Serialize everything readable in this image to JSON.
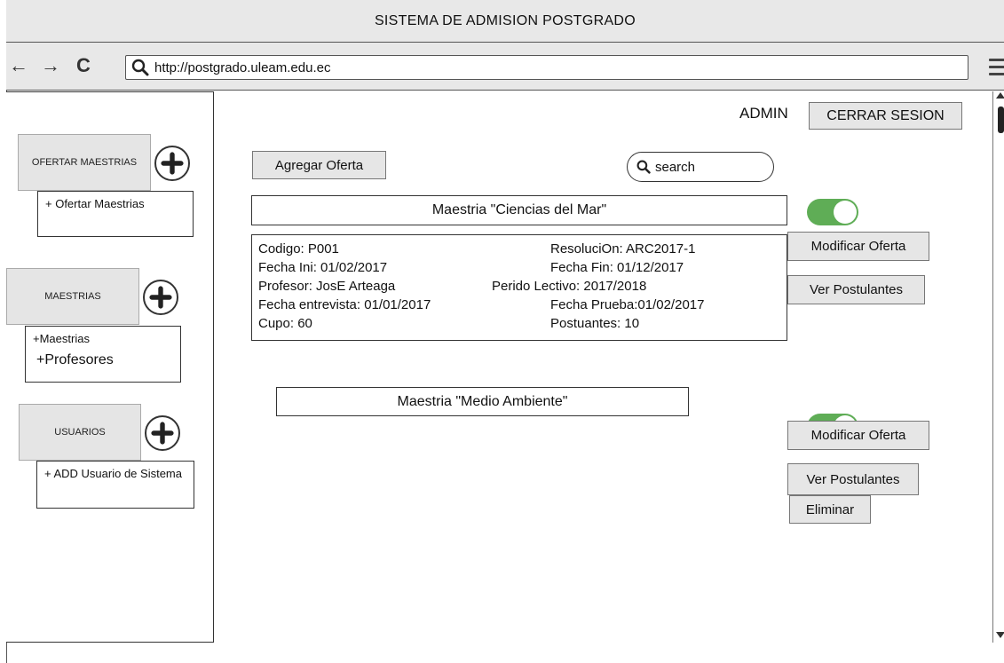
{
  "window": {
    "title": "SISTEMA DE ADMISION POSTGRADO"
  },
  "browser": {
    "back_icon": "←",
    "forward_icon": "→",
    "reload_icon": "C",
    "url": "http://postgrado.uleam.edu.ec"
  },
  "sidebar": {
    "ofertar": {
      "button": "OFERTAR MAESTRIAS",
      "items": [
        "+ Ofertar Maestrias"
      ]
    },
    "maestrias": {
      "button": "MAESTRIAS",
      "items": [
        "+Maestrias",
        "+Profesores"
      ]
    },
    "usuarios": {
      "button": "USUARIOS",
      "items": [
        "+ ADD Usuario de Sistema"
      ]
    }
  },
  "header": {
    "user": "ADMIN",
    "logout": "CERRAR SESION"
  },
  "actions": {
    "add_offer": "Agregar Oferta",
    "search_placeholder": "search"
  },
  "offers": [
    {
      "title": "Maestria \"Ciencias del Mar\"",
      "enabled": true,
      "details": {
        "codigo": "Codigo: P001",
        "resolucion": "ResoluciOn: ARC2017-1",
        "fecha_ini": "Fecha Ini: 01/02/2017",
        "fecha_fin": "Fecha Fin: 01/12/2017",
        "profesor": "Profesor: JosE Arteaga",
        "periodo": "Perido Lectivo: 2017/2018",
        "fecha_entrevista": "Fecha entrevista: 01/01/2017",
        "fecha_prueba": "Fecha Prueba:01/02/2017",
        "cupo": "Cupo: 60",
        "postulantes": "Postuantes: 10"
      },
      "buttons": {
        "modify": "Modificar Oferta",
        "view": "Ver Postulantes"
      }
    },
    {
      "title": "Maestria \"Medio Ambiente\"",
      "enabled": true,
      "buttons": {
        "modify": "Modificar Oferta",
        "view": "Ver Postulantes",
        "delete": "Eliminar"
      }
    }
  ],
  "colors": {
    "toggle_on": "#5fad56",
    "button_bg": "#e6e6e6",
    "chrome_bg": "#e8e8e8"
  }
}
